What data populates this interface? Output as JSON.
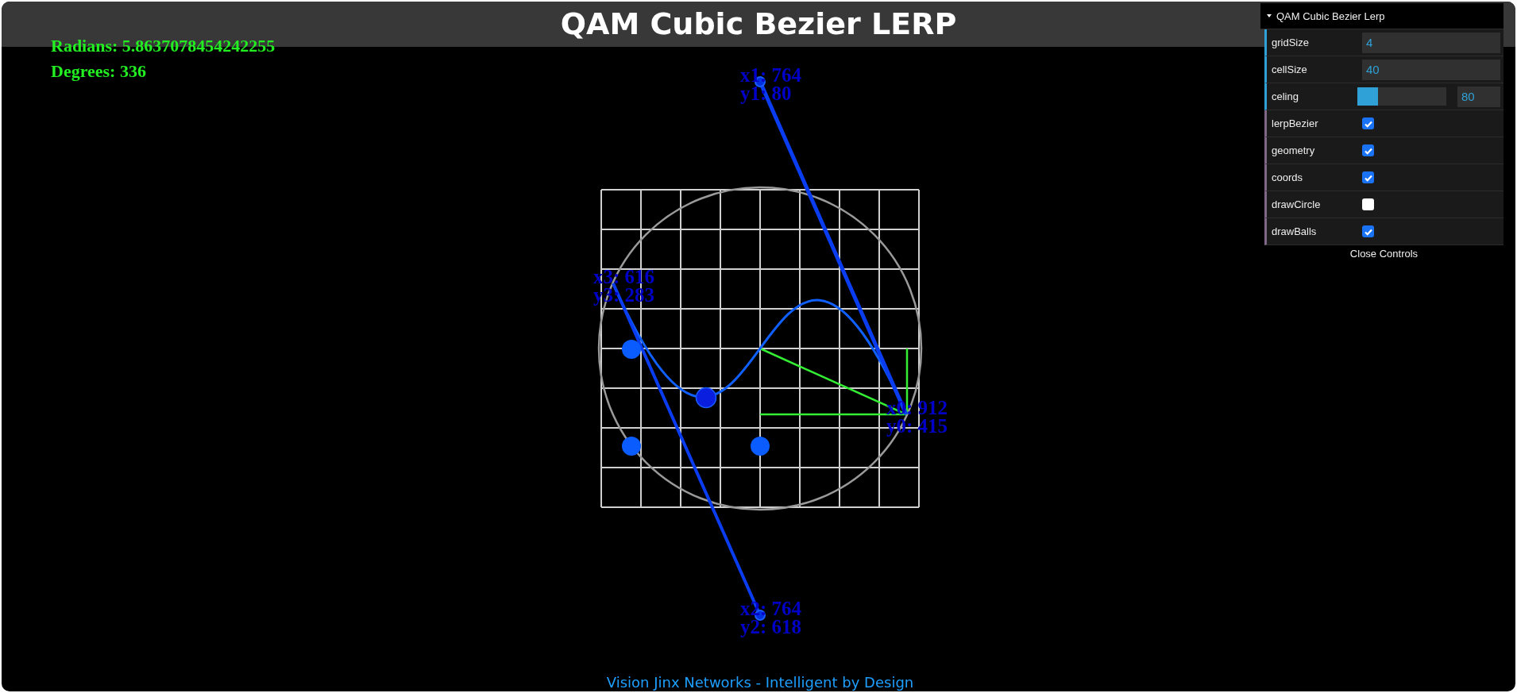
{
  "title": "QAM Cubic Bezier LERP",
  "readouts": [
    "Radians: 5.8637078454242255",
    "Degrees: 336"
  ],
  "points": [
    {
      "label_x": "x0: 912",
      "label_y": "y0: 415"
    },
    {
      "label_x": "x1: 764",
      "label_y": "y1: 80"
    },
    {
      "label_x": "x2: 764",
      "label_y": "y2: 618"
    },
    {
      "label_x": "x3: 616",
      "label_y": "y3: 283"
    }
  ],
  "footer": "Vision Jinx Networks - Intelligent by Design",
  "controls": {
    "title": "QAM Cubic Bezier Lerp",
    "expanded": true,
    "items": [
      {
        "kind": "number",
        "label": "gridSize",
        "value": "4"
      },
      {
        "kind": "number",
        "label": "cellSize",
        "value": "40"
      },
      {
        "kind": "slider",
        "label": "celing",
        "level": 0.23,
        "value": "80"
      },
      {
        "kind": "checkbox",
        "label": "lerpBezier",
        "checked": true
      },
      {
        "kind": "checkbox",
        "label": "geometry",
        "checked": true
      },
      {
        "kind": "checkbox",
        "label": "coords",
        "checked": true
      },
      {
        "kind": "checkbox",
        "label": "drawCircle",
        "checked": false
      },
      {
        "kind": "checkbox",
        "label": "drawBalls",
        "checked": true
      }
    ],
    "close_label": "Close Controls"
  }
}
